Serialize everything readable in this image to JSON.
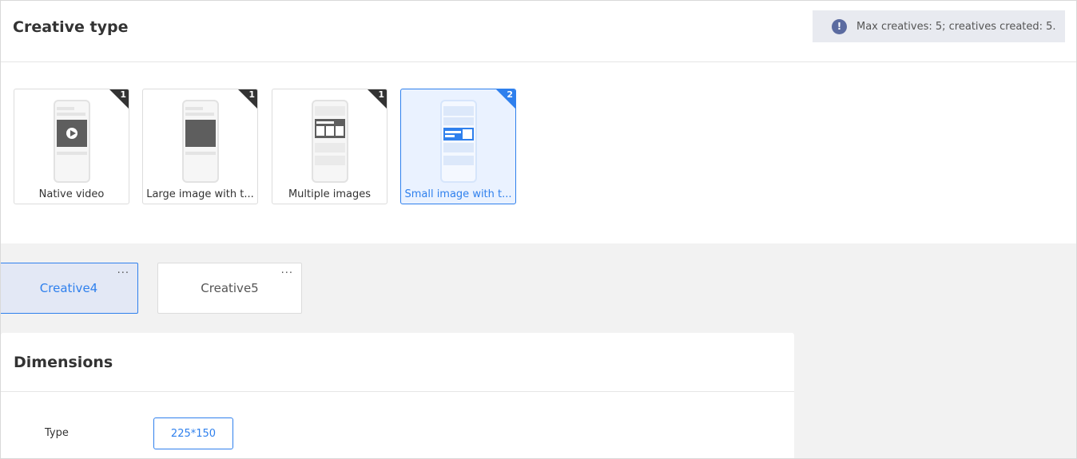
{
  "header": {
    "title": "Creative type",
    "quota_icon": "!",
    "quota_text": "Max creatives: 5; creatives created: 5."
  },
  "creative_types": [
    {
      "label": "Native video",
      "count": "1",
      "icon": "native-video-icon",
      "selected": false
    },
    {
      "label": "Large image with t...",
      "count": "1",
      "icon": "large-image-icon",
      "selected": false
    },
    {
      "label": "Multiple images",
      "count": "1",
      "icon": "multiple-images-icon",
      "selected": false
    },
    {
      "label": "Small image with t...",
      "count": "2",
      "icon": "small-image-icon",
      "selected": true
    }
  ],
  "creatives": [
    {
      "label": "Creative4",
      "more": "...",
      "active": true
    },
    {
      "label": "Creative5",
      "more": "...",
      "active": false
    }
  ],
  "dimensions": {
    "title": "Dimensions",
    "type_label": "Type",
    "selected_size": "225*150"
  },
  "colors": {
    "accent": "#2f80ed",
    "badge": "#333333",
    "info": "#5b6ba0"
  }
}
